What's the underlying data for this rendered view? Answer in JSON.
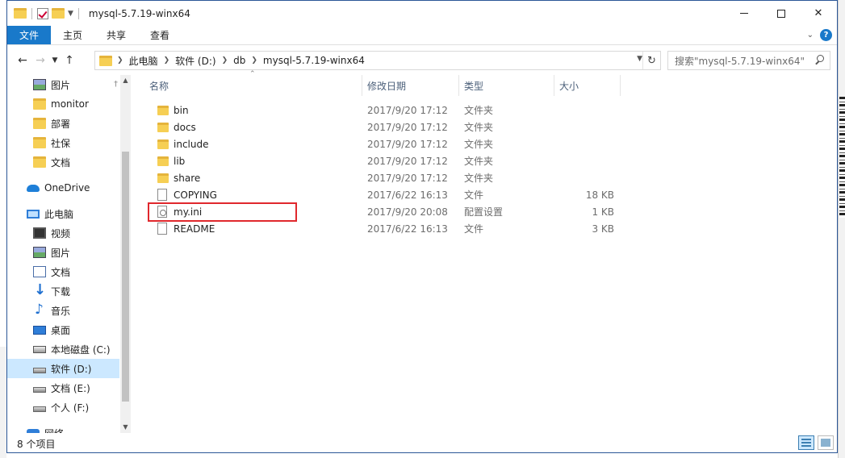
{
  "window": {
    "title": "mysql-5.7.19-winx64"
  },
  "ribbon": {
    "tabs": [
      "文件",
      "主页",
      "共享",
      "查看"
    ],
    "help_label": "?"
  },
  "address": {
    "crumbs": [
      "此电脑",
      "软件 (D:)",
      "db",
      "mysql-5.7.19-winx64"
    ]
  },
  "search": {
    "placeholder": "搜索\"mysql-5.7.19-winx64\""
  },
  "nav": {
    "items": [
      {
        "label": "图片",
        "icon": "pictures-icon",
        "pinned": true
      },
      {
        "label": "monitor",
        "icon": "folder-icon"
      },
      {
        "label": "部署",
        "icon": "folder-icon"
      },
      {
        "label": "社保",
        "icon": "folder-icon"
      },
      {
        "label": "文档",
        "icon": "folder-icon"
      },
      {
        "label": "OneDrive",
        "icon": "onedrive-icon"
      },
      {
        "label": "此电脑",
        "icon": "this-pc-icon"
      },
      {
        "label": "视频",
        "icon": "videos-icon"
      },
      {
        "label": "图片",
        "icon": "pictures-icon"
      },
      {
        "label": "文档",
        "icon": "documents-icon"
      },
      {
        "label": "下载",
        "icon": "downloads-icon"
      },
      {
        "label": "音乐",
        "icon": "music-icon"
      },
      {
        "label": "桌面",
        "icon": "desktop-icon"
      },
      {
        "label": "本地磁盘 (C:)",
        "icon": "system-drive-icon"
      },
      {
        "label": "软件 (D:)",
        "icon": "drive-icon",
        "selected": true
      },
      {
        "label": "文档 (E:)",
        "icon": "drive-icon"
      },
      {
        "label": "个人 (F:)",
        "icon": "drive-icon"
      },
      {
        "label": "网络",
        "icon": "network-icon"
      }
    ]
  },
  "columns": {
    "name": "名称",
    "modified": "修改日期",
    "type": "类型",
    "size": "大小"
  },
  "files": [
    {
      "name": "bin",
      "modified": "2017/9/20 17:12",
      "type": "文件夹",
      "size": "",
      "icon": "folder-icon"
    },
    {
      "name": "docs",
      "modified": "2017/9/20 17:12",
      "type": "文件夹",
      "size": "",
      "icon": "folder-icon"
    },
    {
      "name": "include",
      "modified": "2017/9/20 17:12",
      "type": "文件夹",
      "size": "",
      "icon": "folder-icon"
    },
    {
      "name": "lib",
      "modified": "2017/9/20 17:12",
      "type": "文件夹",
      "size": "",
      "icon": "folder-icon"
    },
    {
      "name": "share",
      "modified": "2017/9/20 17:12",
      "type": "文件夹",
      "size": "",
      "icon": "folder-icon"
    },
    {
      "name": "COPYING",
      "modified": "2017/6/22 16:13",
      "type": "文件",
      "size": "18 KB",
      "icon": "file-icon"
    },
    {
      "name": "my.ini",
      "modified": "2017/9/20 20:08",
      "type": "配置设置",
      "size": "1 KB",
      "icon": "config-file-icon",
      "highlighted": true
    },
    {
      "name": "README",
      "modified": "2017/6/22 16:13",
      "type": "文件",
      "size": "3 KB",
      "icon": "file-icon"
    }
  ],
  "status": {
    "item_count": "8 个项目"
  },
  "colors": {
    "accent": "#1979ca",
    "selection": "#cce8ff",
    "highlight_box": "#e0282d",
    "folder": "#f6cf54"
  }
}
